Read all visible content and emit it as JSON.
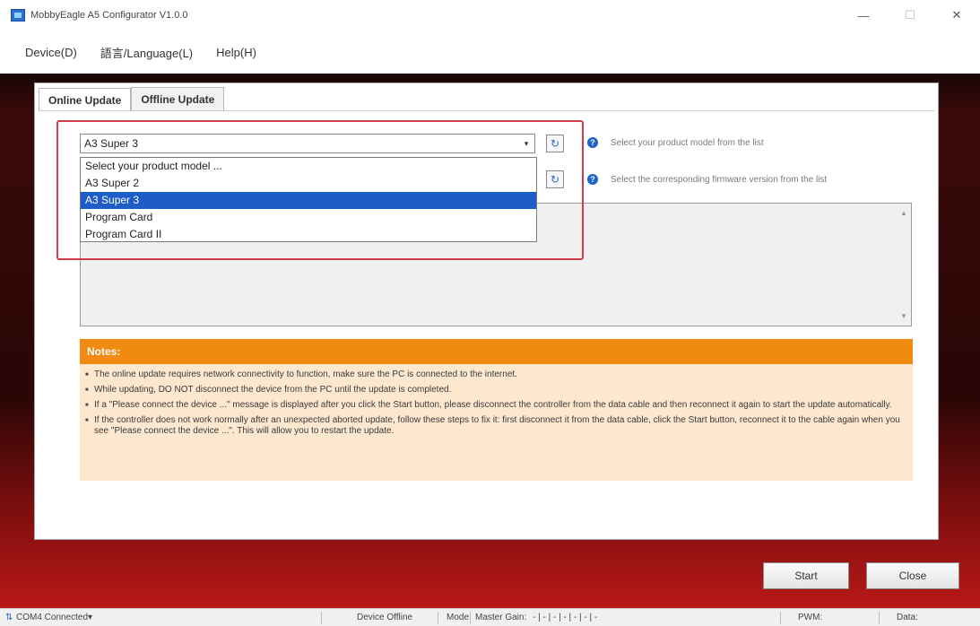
{
  "window": {
    "title": "MobbyEagle A5 Configurator V1.0.0",
    "minimize": "—",
    "maximize": "☐",
    "close": "✕"
  },
  "menu": [
    "Device(D)",
    "語言/Language(L)",
    "Help(H)"
  ],
  "tabs": [
    {
      "label": "Online Update",
      "active": true
    },
    {
      "label": "Offline Update",
      "active": false
    }
  ],
  "product_combo": {
    "value": "A3 Super 3",
    "arrow": "▾"
  },
  "refresh_glyph": "↻",
  "hints": {
    "product": "Select your product model from the list",
    "firmware": "Select the corresponding firmware version from the list"
  },
  "dropdown_options": [
    {
      "label": "Select your product model ...",
      "selected": false
    },
    {
      "label": "A3 Super 2",
      "selected": false
    },
    {
      "label": "A3 Super 3",
      "selected": true
    },
    {
      "label": "Program Card",
      "selected": false
    },
    {
      "label": "Program Card II",
      "selected": false
    }
  ],
  "notes": {
    "title": "Notes:",
    "items": [
      "The online update requires network connectivity to function, make sure the PC is connected to the internet.",
      "While updating, DO NOT disconnect the device from the PC until the update is completed.",
      "If a \"Please connect the device ...\" message is displayed after you click the Start button, please disconnect the controller from the data cable and then reconnect it again to start the update automatically.",
      "If the controller does not work normally after an unexpected aborted update, follow these steps to fix it: first disconnect it from the data cable, click the Start button, reconnect it to the cable again when you see \"Please connect the device ...\". This will allow you to restart the update."
    ]
  },
  "buttons": {
    "start": "Start",
    "close": "Close"
  },
  "statusbar": {
    "port": "COM4 Connected",
    "port_arrow": "▾",
    "device": "Device Offline",
    "mode": "Mode:",
    "master": "Master Gain:",
    "cells": "- | - | - | - | - | - | -",
    "pwm": "PWM:",
    "data": "Data:"
  },
  "accent": "#f08a10",
  "selection_color": "#1e5cc8"
}
